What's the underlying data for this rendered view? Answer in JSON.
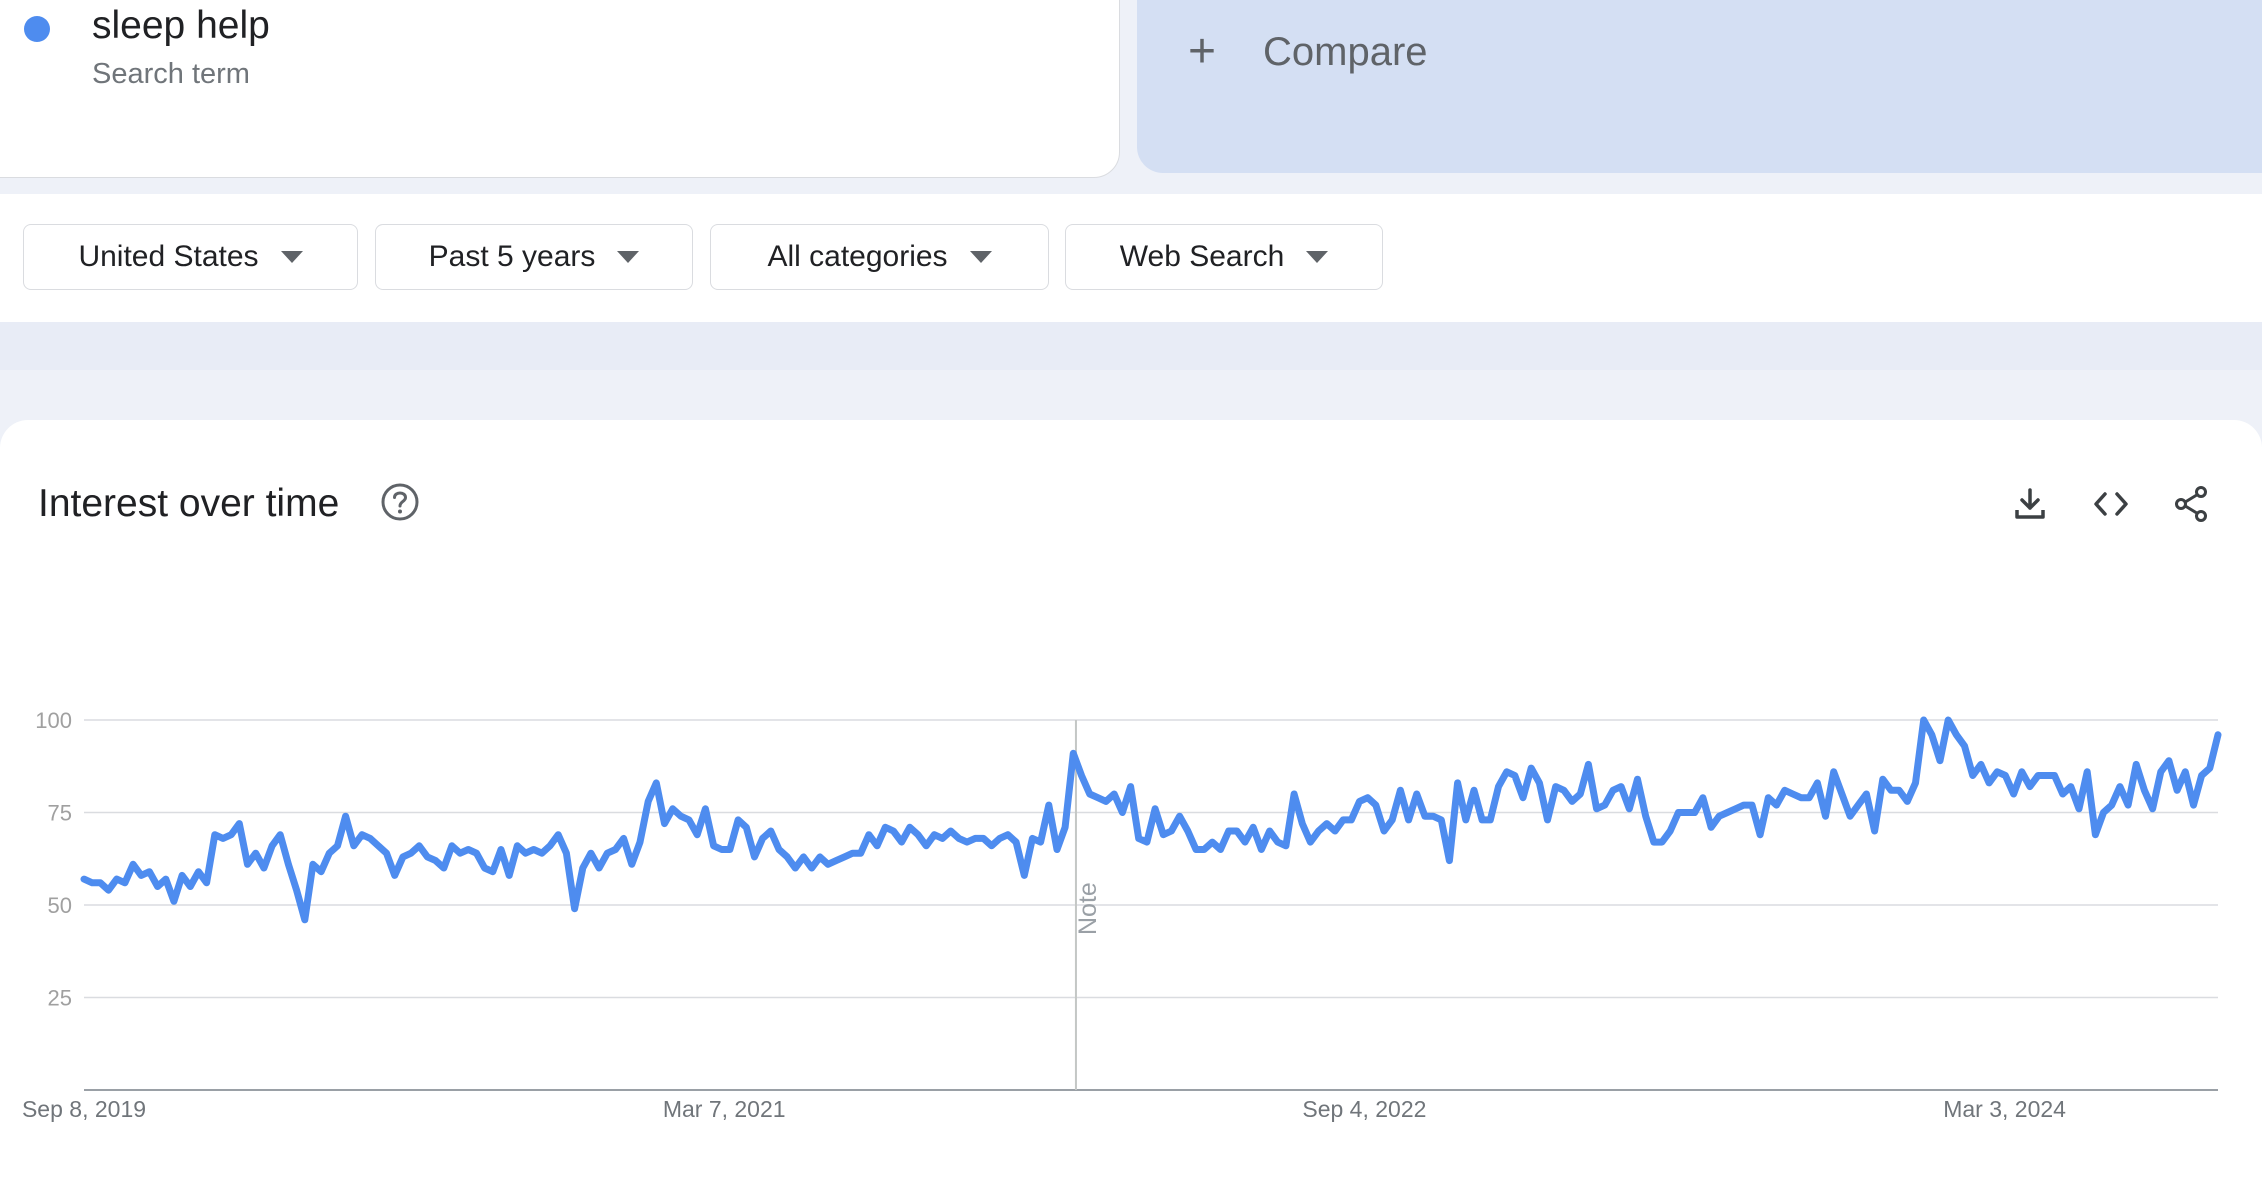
{
  "search_term": {
    "name": "sleep help",
    "subtitle": "Search term",
    "color": "#4e8cef"
  },
  "compare": {
    "label": "Compare",
    "icon": "plus-icon"
  },
  "filters": [
    {
      "label": "United States"
    },
    {
      "label": "Past 5 years"
    },
    {
      "label": "All categories"
    },
    {
      "label": "Web Search"
    }
  ],
  "chart_card": {
    "title": "Interest over time",
    "icons": [
      "help-icon",
      "download-icon",
      "embed-code-icon",
      "share-icon"
    ]
  },
  "chart_data": {
    "type": "line",
    "title": "Interest over time",
    "xlabel": "",
    "ylabel": "",
    "ylim": [
      0,
      100
    ],
    "yticks": [
      25,
      50,
      75,
      100
    ],
    "xtick_labels": [
      "Sep 8, 2019",
      "Mar 7, 2021",
      "Sep 4, 2022",
      "Mar 3, 2024"
    ],
    "x_start": "2019-09-08",
    "x_end": "2024-09-01",
    "interval": "weekly",
    "grid": true,
    "line_color": "#4e8cef",
    "annotation": {
      "label": "Note",
      "date": "2022-01-01"
    },
    "series": [
      {
        "name": "sleep help",
        "values": [
          57,
          56,
          56,
          54,
          57,
          56,
          61,
          58,
          59,
          55,
          57,
          51,
          58,
          55,
          59,
          56,
          69,
          68,
          69,
          72,
          61,
          64,
          60,
          66,
          69,
          61,
          54,
          46,
          61,
          59,
          64,
          66,
          74,
          66,
          69,
          68,
          66,
          64,
          58,
          63,
          64,
          66,
          63,
          62,
          60,
          66,
          64,
          65,
          64,
          60,
          59,
          65,
          58,
          66,
          64,
          65,
          64,
          66,
          69,
          64,
          49,
          60,
          64,
          60,
          64,
          65,
          68,
          61,
          67,
          78,
          83,
          72,
          76,
          74,
          73,
          69,
          76,
          66,
          65,
          65,
          73,
          71,
          63,
          68,
          70,
          65,
          63,
          60,
          63,
          60,
          63,
          61,
          62,
          63,
          64,
          64,
          69,
          66,
          71,
          70,
          67,
          71,
          69,
          66,
          69,
          68,
          70,
          68,
          67,
          68,
          68,
          66,
          68,
          69,
          67,
          58,
          68,
          67,
          77,
          65,
          71,
          91,
          85,
          80,
          79,
          78,
          80,
          75,
          82,
          68,
          67,
          76,
          69,
          70,
          74,
          70,
          65,
          65,
          67,
          65,
          70,
          70,
          67,
          71,
          65,
          70,
          67,
          66,
          80,
          72,
          67,
          70,
          72,
          70,
          73,
          73,
          78,
          79,
          77,
          70,
          73,
          81,
          73,
          80,
          74,
          74,
          73,
          62,
          83,
          73,
          81,
          73,
          73,
          82,
          86,
          85,
          79,
          87,
          83,
          73,
          82,
          81,
          78,
          80,
          88,
          76,
          77,
          81,
          82,
          76,
          84,
          74,
          67,
          67,
          70,
          75,
          75,
          75,
          79,
          71,
          74,
          75,
          76,
          77,
          77,
          69,
          79,
          77,
          81,
          80,
          79,
          79,
          83,
          74,
          86,
          80,
          74,
          77,
          80,
          70,
          84,
          81,
          81,
          78,
          83,
          100,
          96,
          89,
          100,
          96,
          93,
          85,
          88,
          83,
          86,
          85,
          80,
          86,
          82,
          85,
          85,
          85,
          80,
          82,
          76,
          86,
          69,
          75,
          77,
          82,
          77,
          88,
          81,
          76,
          86,
          89,
          81,
          86,
          77,
          85,
          87,
          96
        ]
      }
    ]
  }
}
